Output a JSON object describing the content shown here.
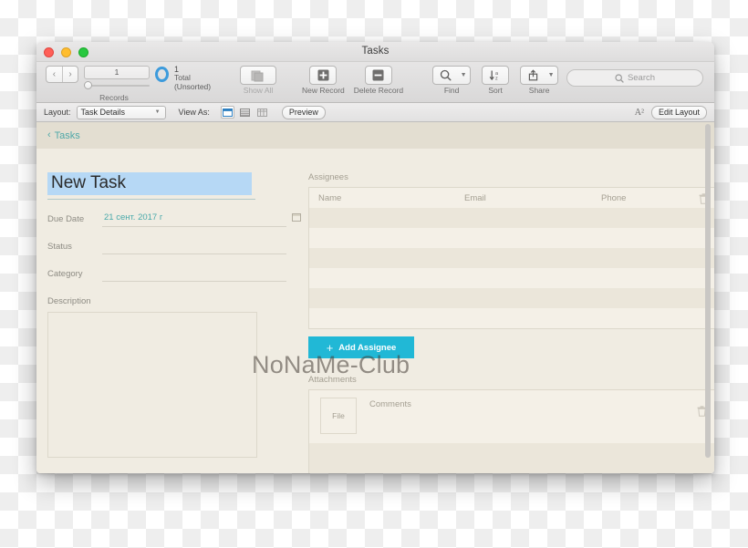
{
  "window": {
    "title": "Tasks",
    "traffic_lights": [
      "close-button",
      "minimize-button",
      "zoom-button"
    ]
  },
  "toolbar": {
    "prev_label": "‹",
    "next_label": "›",
    "record_index": "1",
    "records_caption": "Records",
    "total_count": "1",
    "total_label": "Total (Unsorted)",
    "show_all_label": "Show All",
    "new_record_label": "New Record",
    "delete_record_label": "Delete Record",
    "find_label": "Find",
    "sort_label": "Sort",
    "share_label": "Share",
    "search_placeholder": "Search"
  },
  "layoutbar": {
    "layout_label": "Layout:",
    "layout_value": "Task Details",
    "view_as_label": "View As:",
    "preview_label": "Preview",
    "text_size_icon": "A²",
    "edit_layout_label": "Edit Layout"
  },
  "nav": {
    "back_chevron": "‹",
    "back_label": "Tasks"
  },
  "record": {
    "title": "New Task",
    "fields": [
      {
        "label": "Due Date",
        "value": "21 сент. 2017 г",
        "has_calendar": true
      },
      {
        "label": "Status",
        "value": "",
        "has_calendar": false
      },
      {
        "label": "Category",
        "value": "",
        "has_calendar": false
      }
    ],
    "description_label": "Description",
    "description_value": ""
  },
  "assignees": {
    "section_label": "Assignees",
    "columns": [
      "Name",
      "Email",
      "Phone"
    ],
    "delete_icon": "trash-icon",
    "rows": [],
    "add_button_label": "Add Assignee",
    "add_button_plus": "+",
    "accent_color": "#21b8d6"
  },
  "attachments": {
    "section_label": "Attachments",
    "file_label": "File",
    "comments_label": "Comments",
    "delete_icon": "trash-icon"
  },
  "watermark": {
    "text": "NoNaMe-Club"
  }
}
